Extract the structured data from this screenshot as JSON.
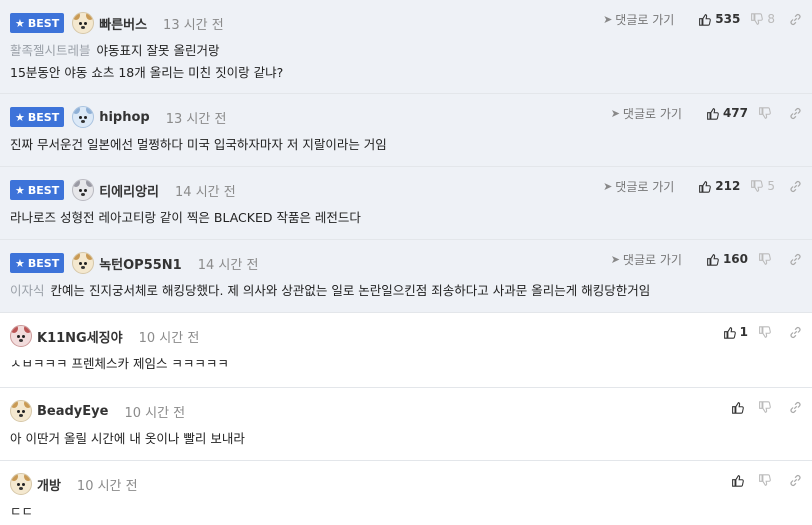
{
  "labels": {
    "best": "BEST",
    "reply": "댓글로 가기"
  },
  "comments": [
    {
      "best": true,
      "nickname": "빠른버스",
      "time": "13 시간 전",
      "cited_user": "활족젤시트레블",
      "lines": [
        "야동표지 잘못 올린거랑",
        "15분동안 야동 쇼츠 18개 올리는 미친 짓이랑 같냐?"
      ],
      "up": "535",
      "down": "8"
    },
    {
      "best": true,
      "nickname": "hiphop",
      "time": "13 시간 전",
      "cited_user": "",
      "lines": [
        "진짜 무서운건 일본에선 멀쩡하다 미국 입국하자마자 저 지랄이라는 거임"
      ],
      "up": "477",
      "down": ""
    },
    {
      "best": true,
      "nickname": "티에리앙리",
      "time": "14 시간 전",
      "cited_user": "",
      "lines": [
        "라나로즈 성형전 레아고티랑 같이 찍은 BLACKED 작품은 레전드다"
      ],
      "up": "212",
      "down": "5"
    },
    {
      "best": true,
      "nickname": "녹턴OP55N1",
      "time": "14 시간 전",
      "cited_user": "이자식",
      "lines": [
        "칸예는 진지궁서체로 해킹당했다. 제 의사와 상관없는 일로 논란일으킨점 죄송하다고 사과문 올리는게 해킹당한거임"
      ],
      "up": "160",
      "down": ""
    },
    {
      "best": false,
      "nickname": "K11NG세징야",
      "time": "10 시간 전",
      "cited_user": "",
      "lines": [
        "ㅅㅂㅋㅋㅋ 프렌체스카 제임스 ㅋㅋㅋㅋㅋ"
      ],
      "up": "1",
      "down": ""
    },
    {
      "best": false,
      "nickname": "BeadyEye",
      "time": "10 시간 전",
      "cited_user": "",
      "lines": [
        "아 이딴거 올릴 시간에 내 옷이나 빨리 보내라"
      ],
      "up": "",
      "down": ""
    },
    {
      "best": false,
      "nickname": "개방",
      "time": "10 시간 전",
      "cited_user": "",
      "lines": [
        "ㄷㄷ"
      ],
      "up": "",
      "down": ""
    }
  ],
  "colors": {
    "best_badge": "#3d73d9",
    "best_row_bg": "#eef1f6"
  },
  "icons": {
    "upvote": "thumbs-up-icon",
    "downvote": "thumbs-down-icon",
    "share": "link-icon",
    "reply": "arrow-icon"
  }
}
